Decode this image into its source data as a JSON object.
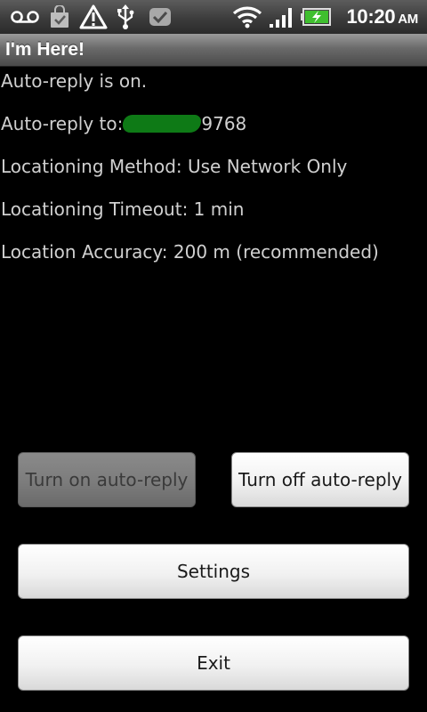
{
  "status_bar": {
    "time": "10:20",
    "ampm": "AM",
    "icons": [
      "voicemail-icon",
      "shopping-bag-icon",
      "warning-icon",
      "usb-icon",
      "shield-check-icon",
      "wifi-icon",
      "signal-icon",
      "battery-charging-icon"
    ]
  },
  "app": {
    "title": "I'm Here!"
  },
  "info": {
    "status": "Auto-reply is on.",
    "reply_to_label": "Auto-reply to:",
    "reply_to_suffix": "9768",
    "method": "Locationing Method: Use Network Only",
    "timeout": "Locationing Timeout: 1 min",
    "accuracy": "Location Accuracy: 200 m (recommended)"
  },
  "buttons": {
    "turn_on": "Turn on auto-reply",
    "turn_off": "Turn off auto-reply",
    "settings": "Settings",
    "exit": "Exit"
  },
  "colors": {
    "background": "#000000",
    "text": "#d0d0d0",
    "redaction": "#0e7a16"
  }
}
